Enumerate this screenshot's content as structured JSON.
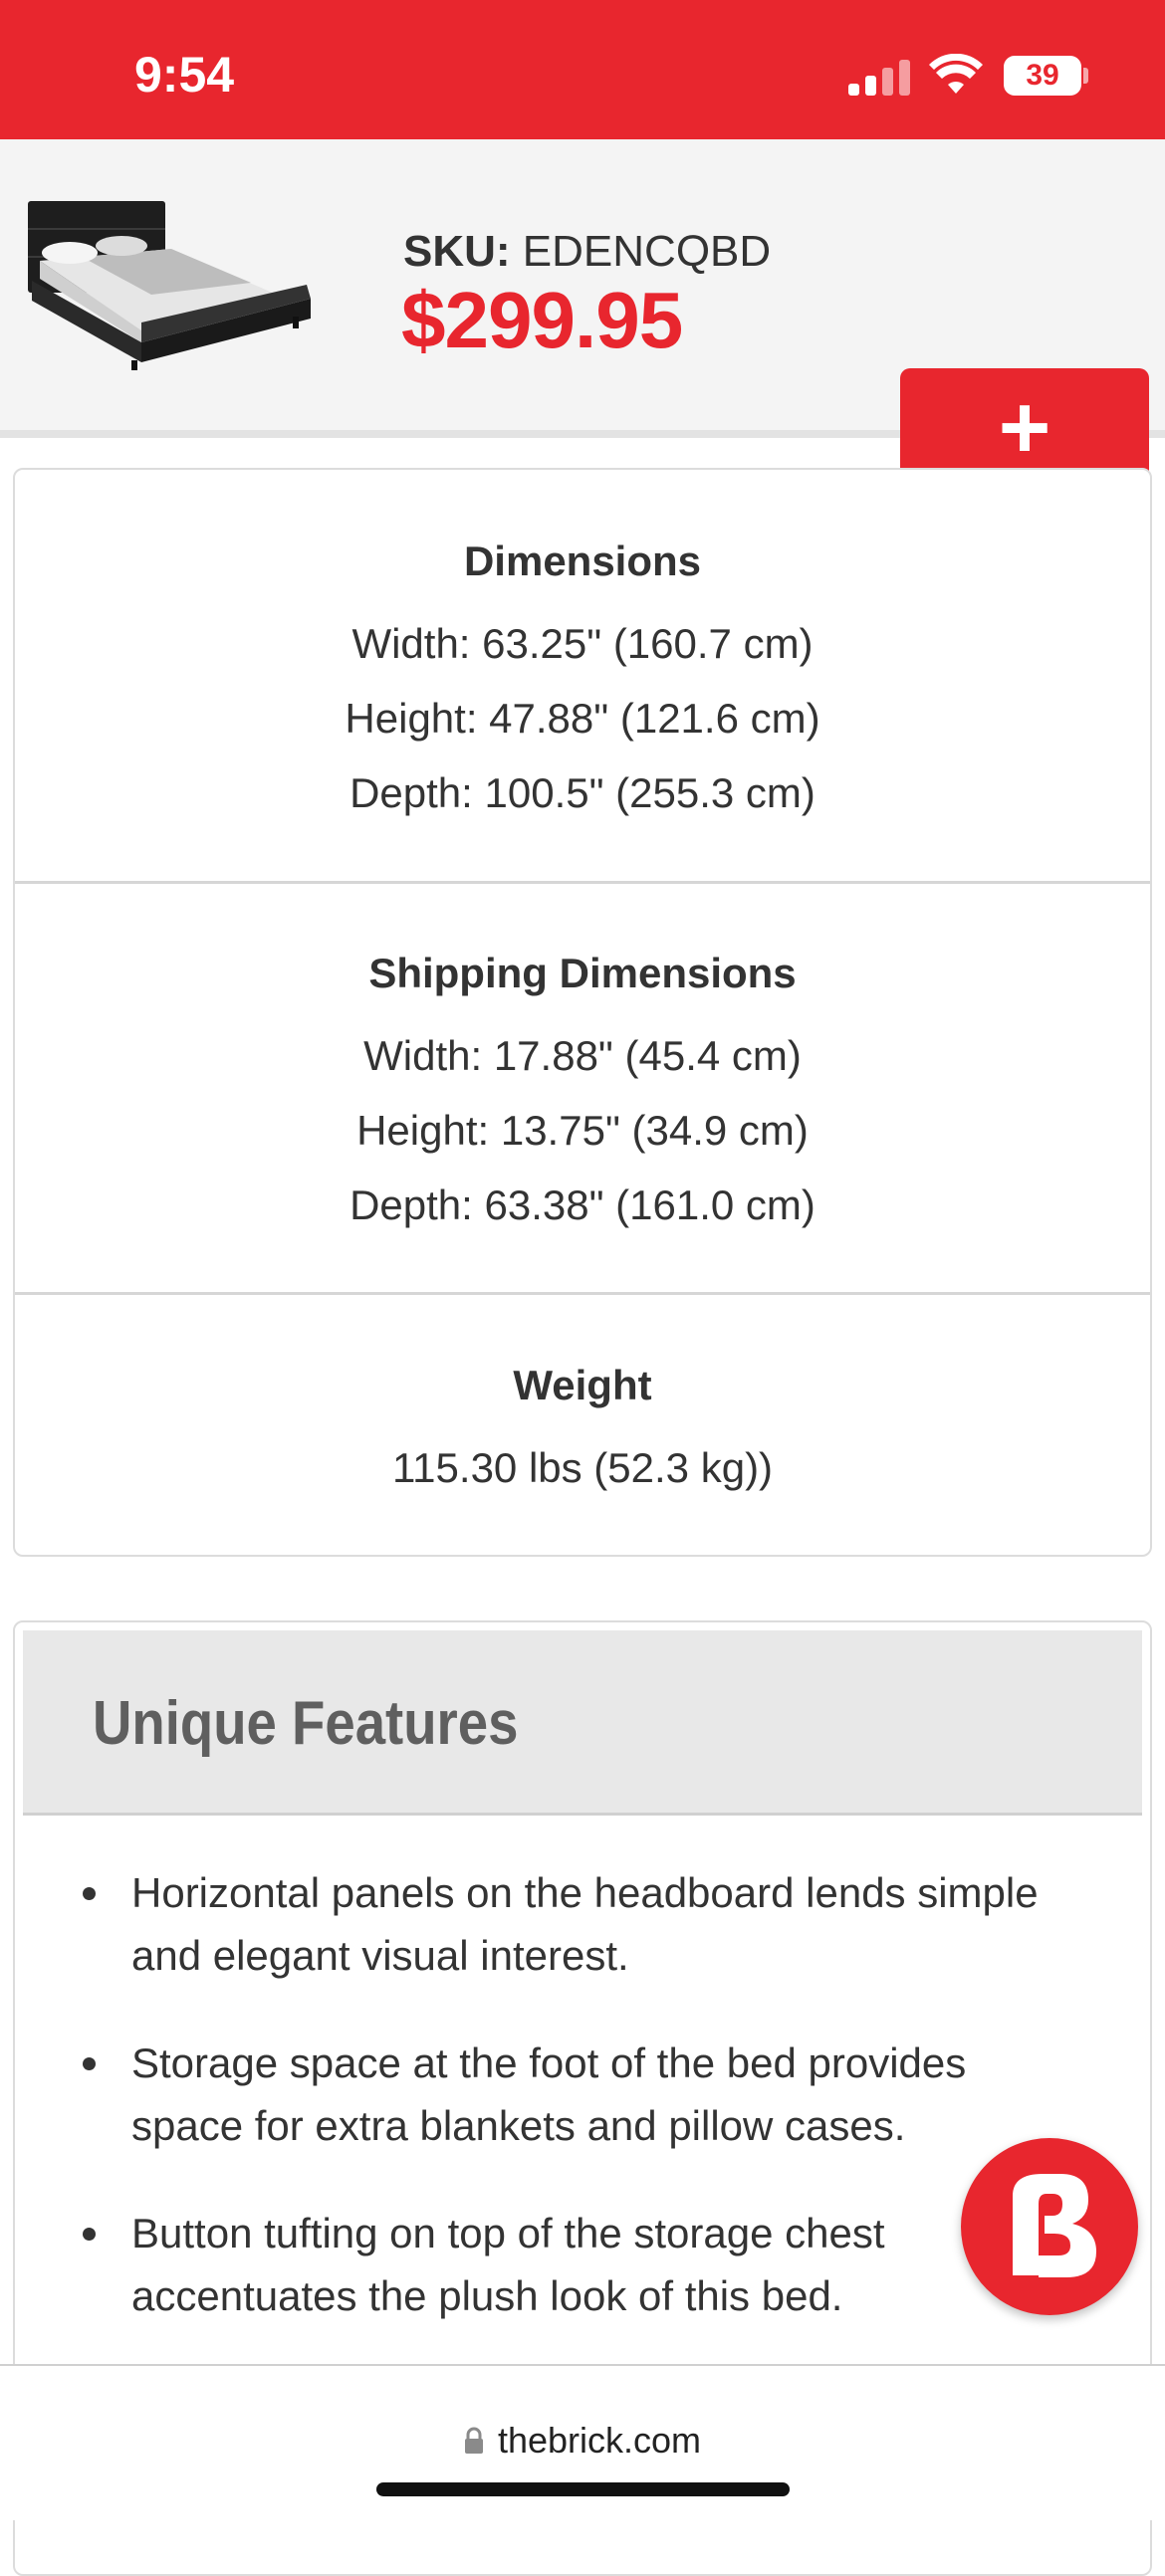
{
  "status_bar": {
    "time": "9:54",
    "battery": "39",
    "background_color": "#e8262e"
  },
  "product_bar": {
    "image_alt": "Bed with storage bench",
    "sku_label": "SKU:",
    "sku_value": "EDENCQBD",
    "price": "$299.95",
    "add_label": "+",
    "price_color": "#e8262e"
  },
  "specs": {
    "dimensions": {
      "title": "Dimensions",
      "lines": [
        "Width: 63.25\" (160.7 cm)",
        "Height: 47.88\" (121.6 cm)",
        "Depth: 100.5\" (255.3 cm)"
      ]
    },
    "shipping": {
      "title": "Shipping Dimensions",
      "lines": [
        "Width: 17.88\" (45.4 cm)",
        "Height: 13.75\" (34.9 cm)",
        "Depth: 63.38\" (161.0 cm)"
      ]
    },
    "weight": {
      "title": "Weight",
      "lines": [
        "115.30 lbs (52.3 kg))"
      ]
    }
  },
  "features": {
    "title": "Unique Features",
    "items": [
      "Horizontal panels on the headboard lends simple and elegant visual interest.",
      "Storage space at the foot of the bed provides space for extra blankets and pillow cases.",
      "Button tufting on top of the storage chest accentuates the plush look of this bed."
    ]
  },
  "fab": {
    "icon": "brick-logo-icon"
  },
  "browser": {
    "url": "thebrick.com",
    "icon": "lock-icon"
  }
}
